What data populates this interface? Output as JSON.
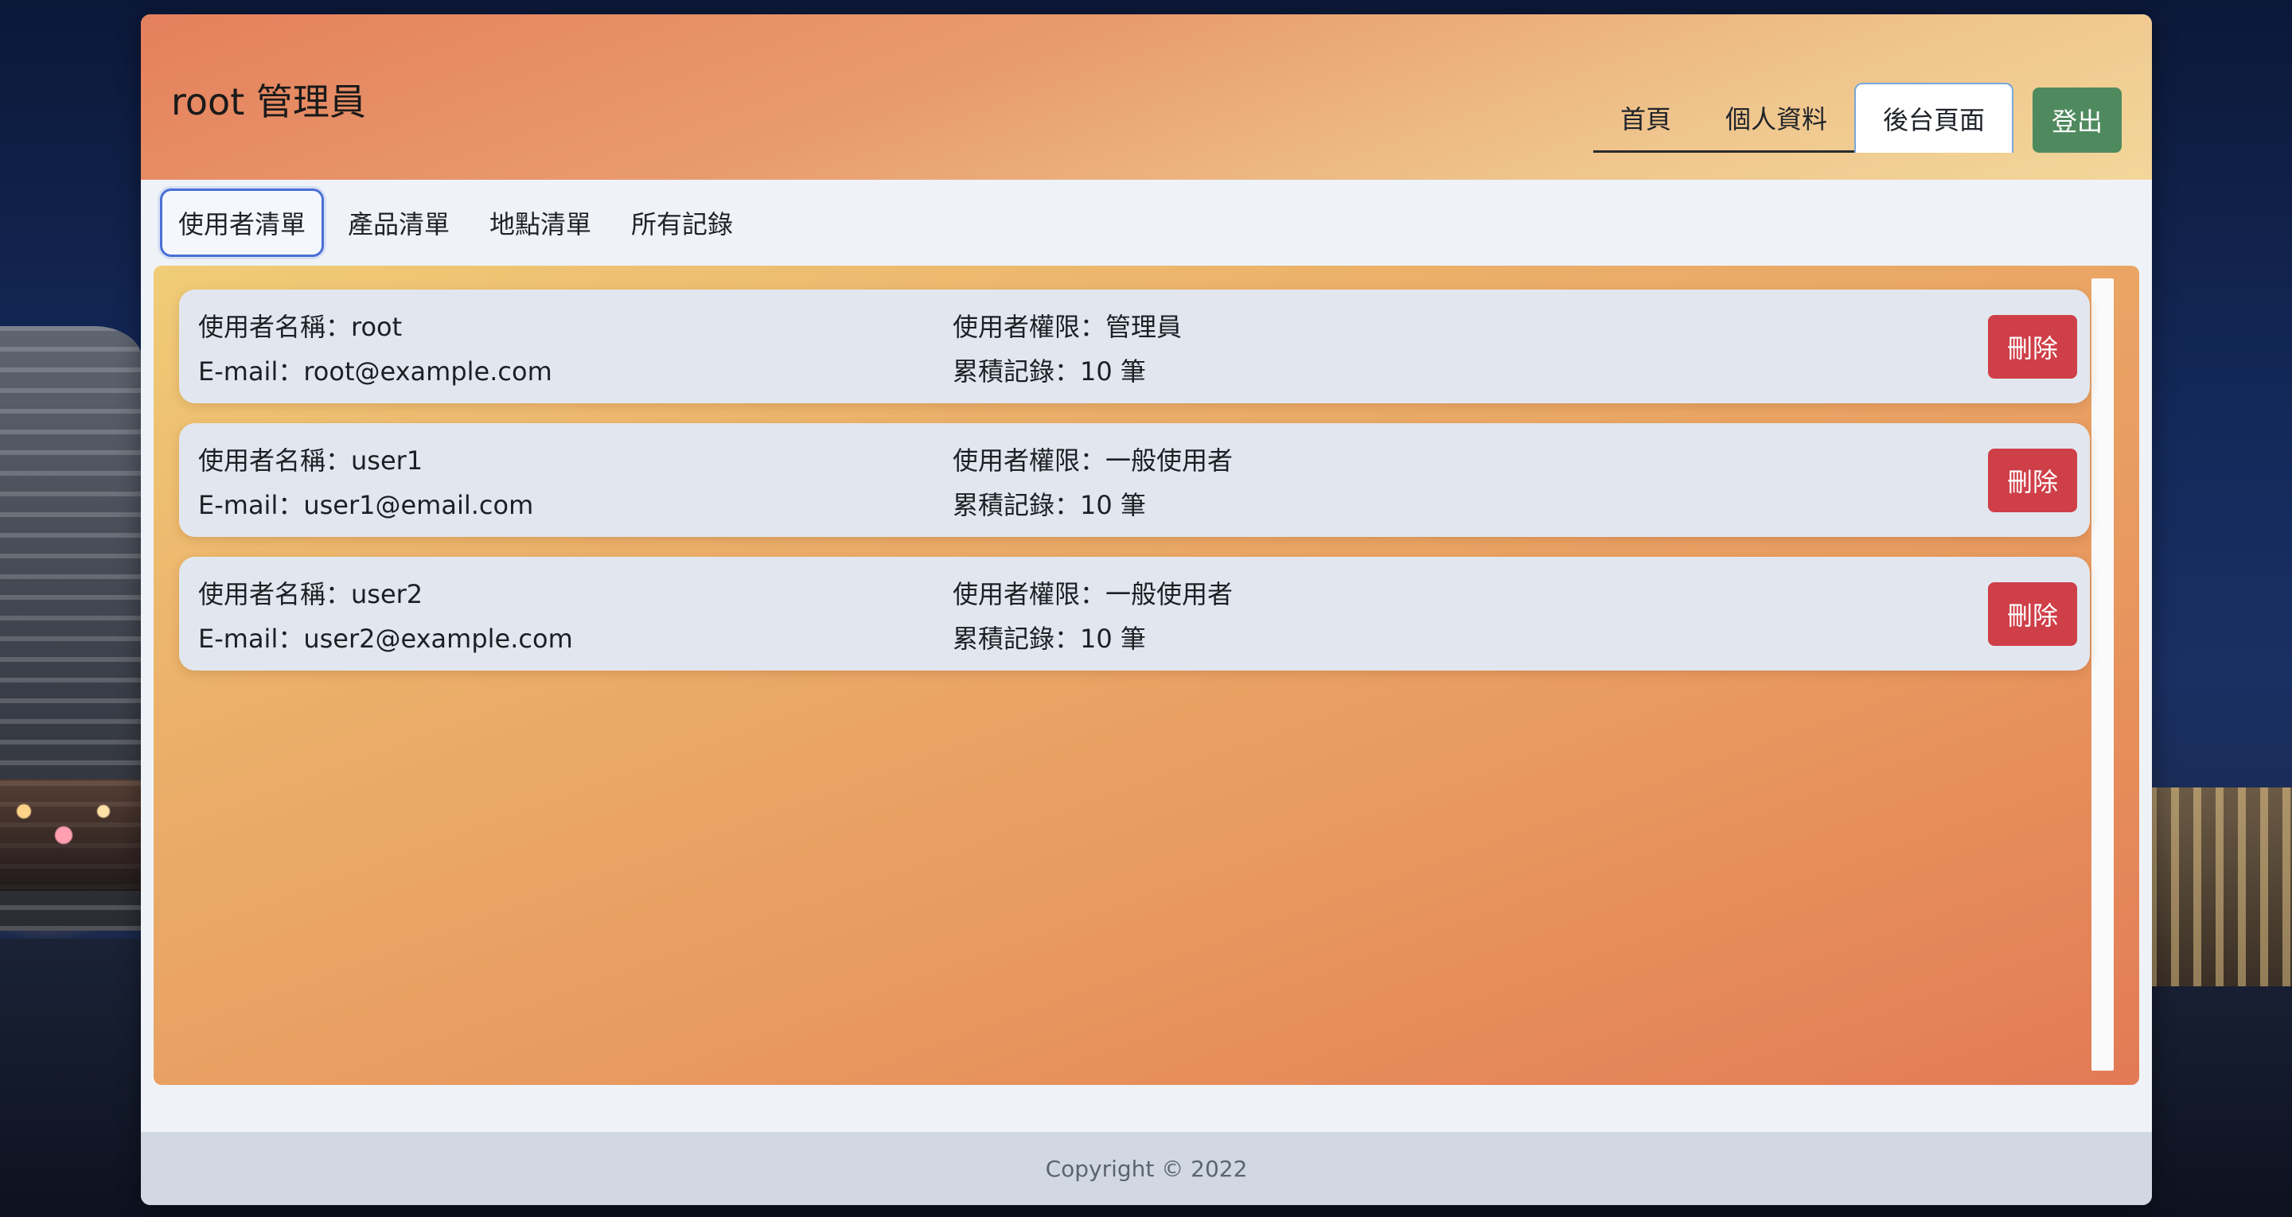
{
  "header": {
    "brand": "root 管理員",
    "nav": [
      {
        "label": "首頁",
        "active": false
      },
      {
        "label": "個人資料",
        "active": false
      },
      {
        "label": "後台頁面",
        "active": true
      }
    ],
    "logout_label": "登出"
  },
  "subnav": [
    {
      "label": "使用者清單",
      "active": true
    },
    {
      "label": "產品清單",
      "active": false
    },
    {
      "label": "地點清單",
      "active": false
    },
    {
      "label": "所有記錄",
      "active": false
    }
  ],
  "users": [
    {
      "name": "使用者名稱：root",
      "email": "E-mail：root@example.com",
      "role": "使用者權限：管理員",
      "records": "累積記錄：10 筆",
      "delete_label": "刪除"
    },
    {
      "name": "使用者名稱：user1",
      "email": "E-mail：user1@email.com",
      "role": "使用者權限：一般使用者",
      "records": "累積記錄：10 筆",
      "delete_label": "刪除"
    },
    {
      "name": "使用者名稱：user2",
      "email": "E-mail：user2@example.com",
      "role": "使用者權限：一般使用者",
      "records": "累積記錄：10 筆",
      "delete_label": "刪除"
    }
  ],
  "footer": {
    "copyright": "Copyright © 2022"
  },
  "colors": {
    "logout": "#4f8a5e",
    "delete": "#cf3f48",
    "active_subnav_border": "#4a70d6"
  }
}
